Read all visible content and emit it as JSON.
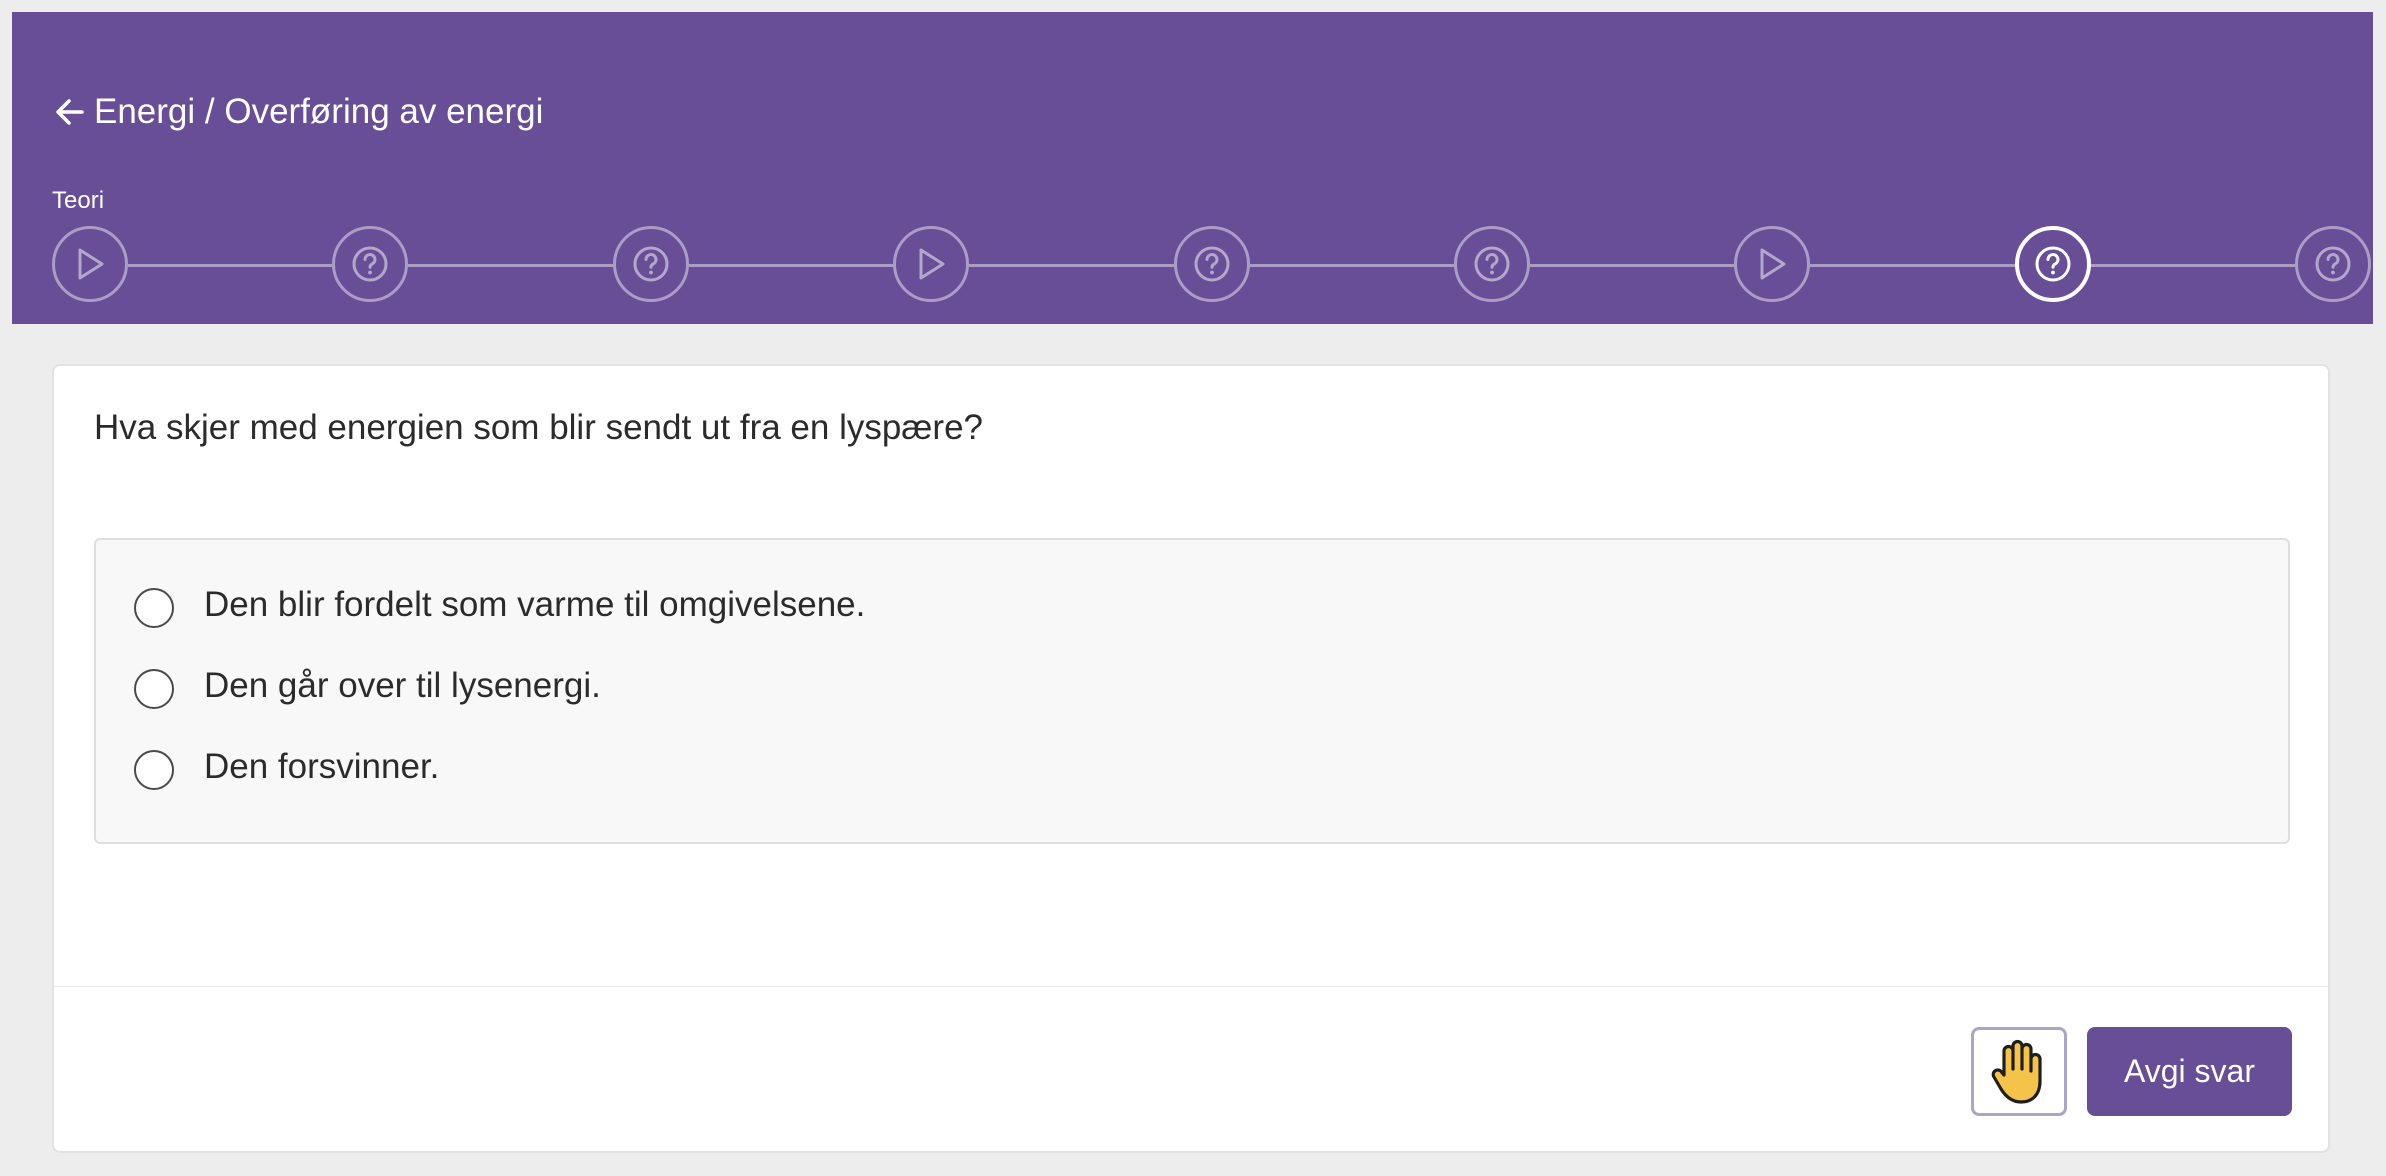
{
  "header": {
    "breadcrumb": "Energi / Overføring av energi",
    "section_label": "Teori",
    "background_color": "#674e96",
    "steps": [
      {
        "icon": "play-icon",
        "state": "default"
      },
      {
        "icon": "question-icon",
        "state": "default"
      },
      {
        "icon": "question-icon",
        "state": "default"
      },
      {
        "icon": "play-icon",
        "state": "default"
      },
      {
        "icon": "question-icon",
        "state": "default"
      },
      {
        "icon": "question-icon",
        "state": "default"
      },
      {
        "icon": "play-icon",
        "state": "default"
      },
      {
        "icon": "question-icon",
        "state": "active"
      },
      {
        "icon": "question-icon",
        "state": "default"
      }
    ]
  },
  "question": {
    "text": "Hva skjer med energien som blir sendt ut fra en lyspære?",
    "options": [
      {
        "label": "Den blir fordelt som varme til omgivelsene.",
        "selected": false
      },
      {
        "label": "Den går over til lysenergi.",
        "selected": false
      },
      {
        "label": "Den forsvinner.",
        "selected": false
      }
    ]
  },
  "footer": {
    "hand_icon": "raised-hand-icon",
    "submit_label": "Avgi svar",
    "accent_color": "#674e96"
  }
}
